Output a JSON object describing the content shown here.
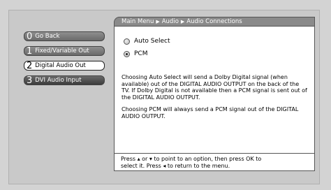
{
  "breadcrumb": {
    "parts": [
      "Main Menu",
      "Audio",
      "Audio Connections"
    ],
    "separator": "▶"
  },
  "menu": {
    "items": [
      {
        "number": "0",
        "label": "Go Back"
      },
      {
        "number": "1",
        "label": "Fixed/Variable Out"
      },
      {
        "number": "2",
        "label": "Digital Audio Out"
      },
      {
        "number": "3",
        "label": "DVI Audio Input"
      }
    ],
    "selected_index": 2
  },
  "options": {
    "items": [
      "Auto Select",
      "PCM"
    ],
    "selected": "PCM"
  },
  "description": {
    "paragraph1": "Choosing Auto Select will send a Dolby Digital signal (when available) out of the DIGITAL AUDIO OUTPUT on the back of the TV. If Dolby Digital is not available then a PCM signal is sent out of the DIGITAL AUDIO OUTPUT.",
    "paragraph2": "Choosing PCM will always send a PCM signal out of the DIGITAL AUDIO OUTPUT."
  },
  "help": {
    "line1": "Press ▴ or ▾ to point to an option, then press OK to",
    "line2": "select it. Press ◂ to return to the menu."
  }
}
